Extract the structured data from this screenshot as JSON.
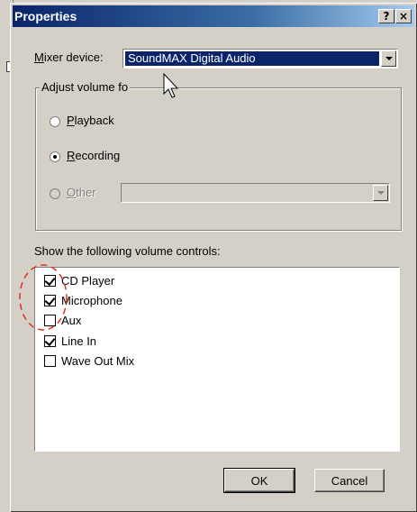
{
  "dialog": {
    "title": "Properties",
    "help_glyph": "?",
    "close_glyph": "×"
  },
  "mixer": {
    "label_prefix": "",
    "label_ul": "M",
    "label_rest": "ixer device:",
    "value": "SoundMAX Digital Audio"
  },
  "adjust_group": {
    "label": "Adjust volume fo",
    "options": [
      {
        "ul": "P",
        "rest": "layback",
        "selected": false,
        "enabled": true
      },
      {
        "ul": "R",
        "rest": "ecording",
        "selected": true,
        "enabled": true
      },
      {
        "ul": "O",
        "rest": "ther",
        "selected": false,
        "enabled": false
      }
    ]
  },
  "controls": {
    "label": "Show the following volume controls:",
    "items": [
      {
        "label": "CD Player",
        "checked": true
      },
      {
        "label": "Microphone",
        "checked": true
      },
      {
        "label": "Aux",
        "checked": false
      },
      {
        "label": "Line In",
        "checked": true
      },
      {
        "label": "Wave Out Mix",
        "checked": false
      }
    ]
  },
  "buttons": {
    "ok": "OK",
    "cancel": "Cancel"
  },
  "colors": {
    "titlebar": "#0a246a",
    "annotation": "#e0301e"
  }
}
